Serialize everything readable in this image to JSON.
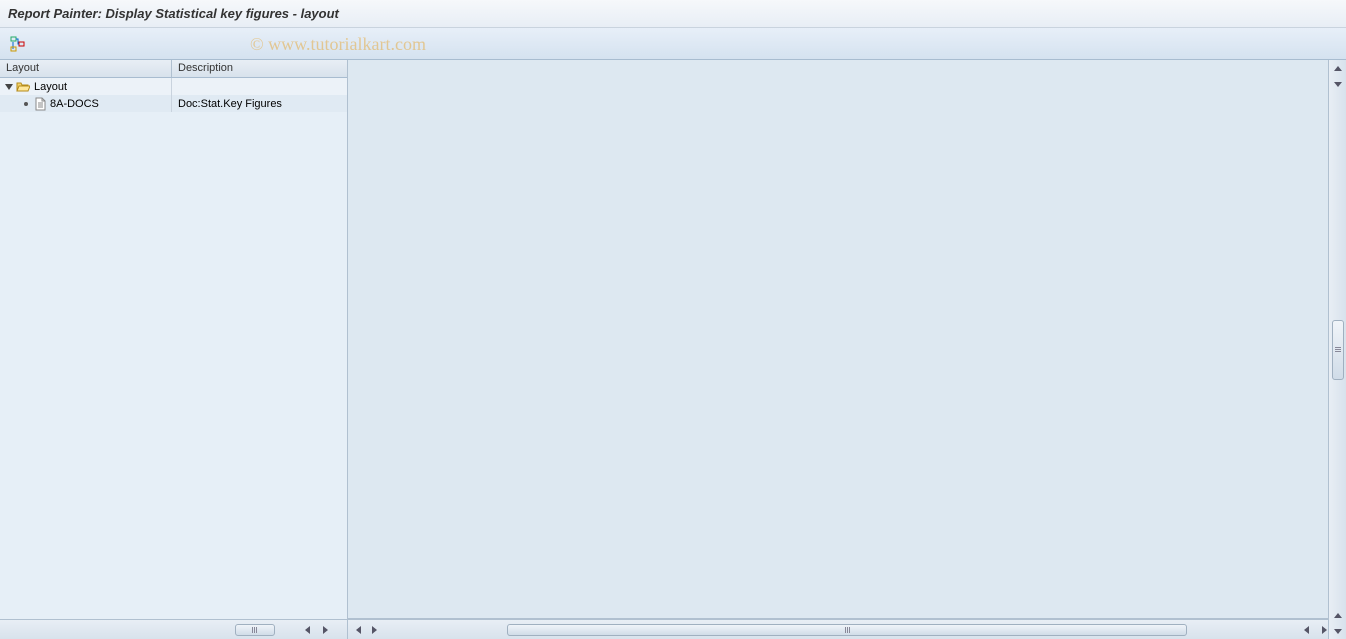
{
  "title": "Report Painter: Display Statistical key figures - layout",
  "watermark": "© www.tutorialkart.com",
  "columns": {
    "layout": "Layout",
    "description": "Description"
  },
  "tree": {
    "root": {
      "label": "Layout",
      "description": ""
    },
    "children": [
      {
        "label": "8A-DOCS",
        "description": "Doc:Stat.Key Figures"
      }
    ]
  }
}
